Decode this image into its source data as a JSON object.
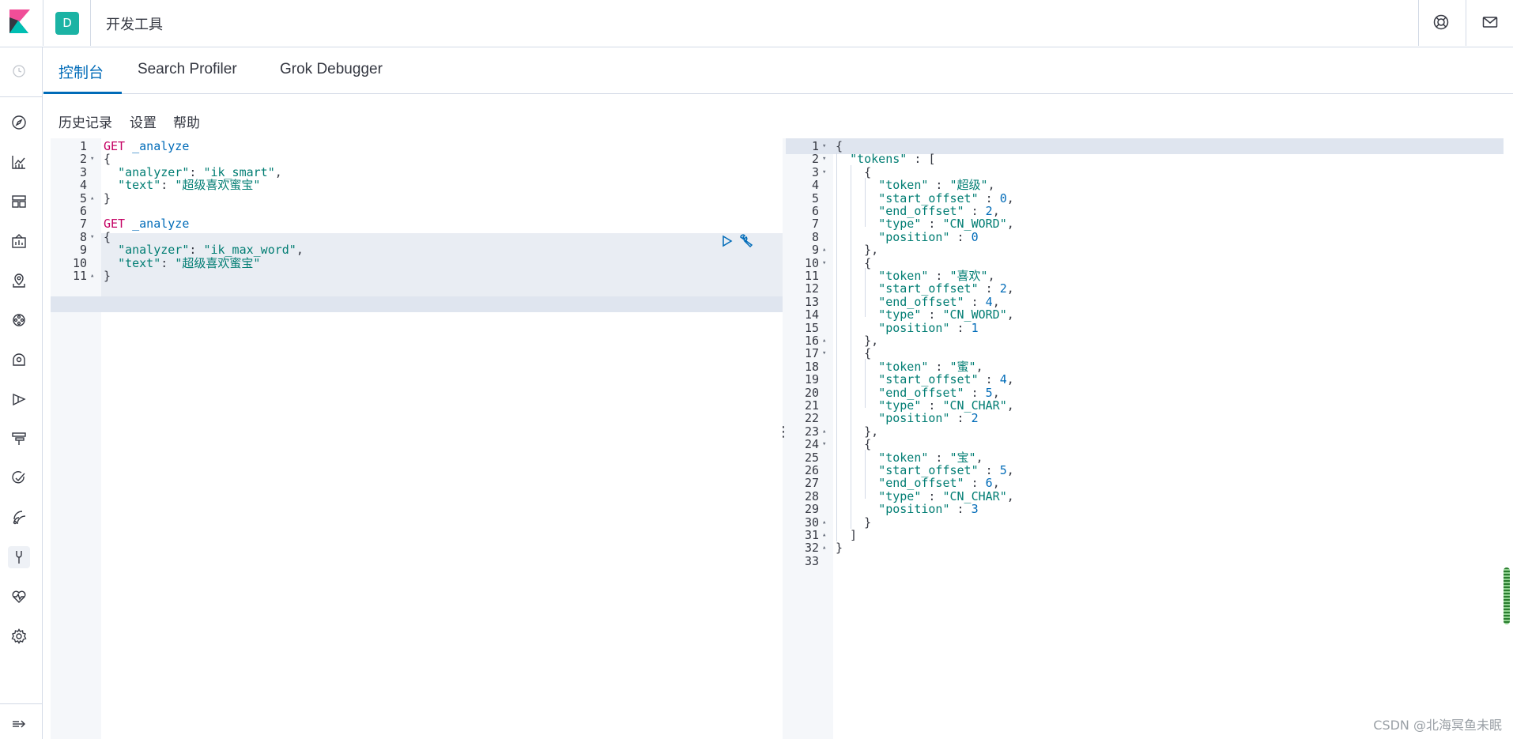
{
  "header": {
    "space_initial": "D",
    "title": "开发工具",
    "help_icon": "help-lifebuoy-icon",
    "mail_icon": "mail-icon"
  },
  "sidenav": {
    "items": [
      {
        "icon": "recent-clock-icon"
      },
      {
        "icon": "discover-compass-icon"
      },
      {
        "icon": "visualize-chart-icon"
      },
      {
        "icon": "dashboard-icon"
      },
      {
        "icon": "canvas-icon"
      },
      {
        "icon": "maps-icon"
      },
      {
        "icon": "ml-icon"
      },
      {
        "icon": "infrastructure-icon"
      },
      {
        "icon": "logs-icon"
      },
      {
        "icon": "apm-icon"
      },
      {
        "icon": "uptime-icon"
      },
      {
        "icon": "siem-icon"
      },
      {
        "icon": "dev-tools-wrench-icon"
      },
      {
        "icon": "monitoring-heartbeat-icon"
      },
      {
        "icon": "management-gear-icon"
      }
    ],
    "collapse_icon": "collapse-arrow-icon"
  },
  "tabs": [
    {
      "label": "控制台",
      "active": true
    },
    {
      "label": "Search Profiler",
      "active": false
    },
    {
      "label": "Grok Debugger",
      "active": false
    }
  ],
  "toolbar": {
    "history": "历史记录",
    "settings": "设置",
    "help": "帮助"
  },
  "request_editor": {
    "lines": [
      {
        "n": "1",
        "text": "GET _analyze"
      },
      {
        "n": "2",
        "text": "{"
      },
      {
        "n": "3",
        "text": "  \"analyzer\": \"ik_smart\","
      },
      {
        "n": "4",
        "text": "  \"text\": \"超级喜欢蜜宝\""
      },
      {
        "n": "5",
        "text": "}"
      },
      {
        "n": "6",
        "text": ""
      },
      {
        "n": "7",
        "text": "GET _analyze"
      },
      {
        "n": "8",
        "text": "{"
      },
      {
        "n": "9",
        "text": "  \"analyzer\": \"ik_max_word\","
      },
      {
        "n": "10",
        "text": "  \"text\": \"超级喜欢蜜宝\""
      },
      {
        "n": "11",
        "text": "}"
      }
    ],
    "run_icon": "play-triangle-icon",
    "wrench_icon": "wrench-icon"
  },
  "response_editor": {
    "lines": [
      {
        "n": "1",
        "text": "{"
      },
      {
        "n": "2",
        "text": "  \"tokens\" : ["
      },
      {
        "n": "3",
        "text": "    {"
      },
      {
        "n": "4",
        "text": "      \"token\" : \"超级\","
      },
      {
        "n": "5",
        "text": "      \"start_offset\" : 0,"
      },
      {
        "n": "6",
        "text": "      \"end_offset\" : 2,"
      },
      {
        "n": "7",
        "text": "      \"type\" : \"CN_WORD\","
      },
      {
        "n": "8",
        "text": "      \"position\" : 0"
      },
      {
        "n": "9",
        "text": "    },"
      },
      {
        "n": "10",
        "text": "    {"
      },
      {
        "n": "11",
        "text": "      \"token\" : \"喜欢\","
      },
      {
        "n": "12",
        "text": "      \"start_offset\" : 2,"
      },
      {
        "n": "13",
        "text": "      \"end_offset\" : 4,"
      },
      {
        "n": "14",
        "text": "      \"type\" : \"CN_WORD\","
      },
      {
        "n": "15",
        "text": "      \"position\" : 1"
      },
      {
        "n": "16",
        "text": "    },"
      },
      {
        "n": "17",
        "text": "    {"
      },
      {
        "n": "18",
        "text": "      \"token\" : \"蜜\","
      },
      {
        "n": "19",
        "text": "      \"start_offset\" : 4,"
      },
      {
        "n": "20",
        "text": "      \"end_offset\" : 5,"
      },
      {
        "n": "21",
        "text": "      \"type\" : \"CN_CHAR\","
      },
      {
        "n": "22",
        "text": "      \"position\" : 2"
      },
      {
        "n": "23",
        "text": "    },"
      },
      {
        "n": "24",
        "text": "    {"
      },
      {
        "n": "25",
        "text": "      \"token\" : \"宝\","
      },
      {
        "n": "26",
        "text": "      \"start_offset\" : 5,"
      },
      {
        "n": "27",
        "text": "      \"end_offset\" : 6,"
      },
      {
        "n": "28",
        "text": "      \"type\" : \"CN_CHAR\","
      },
      {
        "n": "29",
        "text": "      \"position\" : 3"
      },
      {
        "n": "30",
        "text": "    }"
      },
      {
        "n": "31",
        "text": "  ]"
      },
      {
        "n": "32",
        "text": "}"
      },
      {
        "n": "33",
        "text": ""
      }
    ]
  },
  "watermark": "CSDN @北海冥鱼未眠",
  "colors": {
    "accent": "#006bb8",
    "space_badge": "#1bb3a4",
    "method": "#c40063",
    "string": "#017d73"
  }
}
